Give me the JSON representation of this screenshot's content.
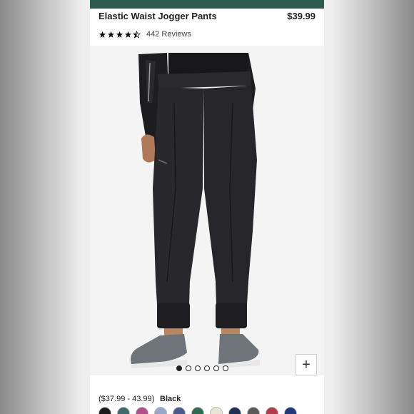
{
  "product": {
    "title": "Elastic Waist Jogger Pants",
    "price": "$39.99",
    "rating": 4.5,
    "reviews_label": "442 Reviews",
    "price_range": "($37.99 - 43.99)",
    "selected_color": "Black"
  },
  "gallery": {
    "image_count": 6,
    "active_index": 0,
    "zoom_icon": "plus-icon"
  },
  "colors": {
    "header_bar": "#2f5a4f",
    "swatches": [
      "#1c1c1c",
      "#3e6b6a",
      "#b04f8c",
      "#9aa7c8",
      "#4a5a8a",
      "#2f6b54",
      "#e8e4d8",
      "#1f2e55",
      "#5a5a5a",
      "#b23a4a",
      "#243a78"
    ]
  }
}
